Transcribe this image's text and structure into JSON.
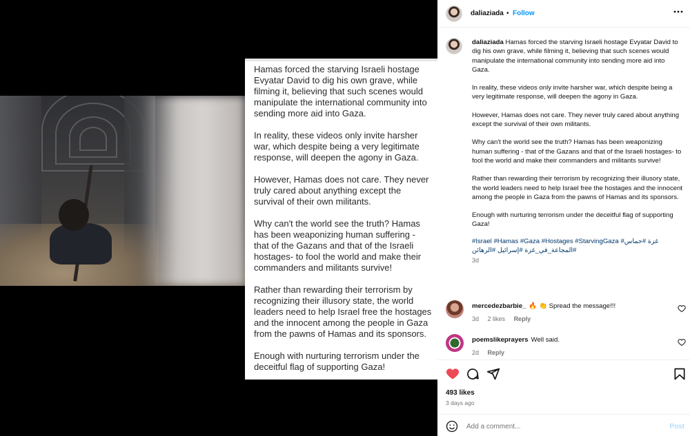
{
  "post": {
    "image_text": {
      "paragraphs": [
        "Hamas forced the starving Israeli hostage Evyatar David to dig his own grave, while filming it, believing that such scenes would manipulate the international community into sending more aid into Gaza.",
        "In reality, these videos only invite harsher war, which despite being a very legitimate response, will deepen the agony in Gaza.",
        "However, Hamas does not care. They never truly cared about anything except the survival of their own militants.",
        "Why can't the world see the truth? Hamas has been weaponizing human suffering - that of the Gazans and that of the Israeli hostages- to fool the world and make their commanders and militants survive!",
        "Rather than rewarding their terrorism by recognizing their illusory state, the world leaders need to help Israel free the hostages and the innocent among the people in Gaza from the pawns of Hamas and its sponsors.",
        "Enough with nurturing terrorism under the deceitful flag of supporting Gaza!"
      ]
    }
  },
  "header": {
    "username": "daliaziada",
    "separator": "•",
    "follow_label": "Follow",
    "more_icon": "more-horizontal-icon"
  },
  "caption": {
    "username": "daliaziada",
    "paragraphs": [
      "Hamas forced the starving Israeli hostage Evyatar David to dig his own grave, while filming it, believing that such scenes would manipulate the international community into sending more aid into Gaza.",
      "In reality, these videos only invite harsher war, which despite being a very legitimate response, will deepen the agony in Gaza.",
      "However, Hamas does not care. They never truly cared about anything except the survival of their own militants.",
      "Why can't the world see the truth? Hamas has been weaponizing human suffering - that of the Gazans and that of the Israeli hostages- to fool the world and make their commanders and militants survive!",
      "Rather than rewarding their terrorism by recognizing their illusory state, the world leaders need to help Israel free the hostages and the innocent among the people in Gaza from the pawns of Hamas and its sponsors.",
      "Enough with nurturing terrorism under the deceitful flag of supporting Gaza!"
    ],
    "hashtags_line1": "#Israel #Hamas #Gaza #Hostages #StarvingGaza #غزة #حماس",
    "hashtags_line2": "#المجاعة_في_غزة #إسرائيل #الرهائن",
    "time": "3d"
  },
  "comments": [
    {
      "username": "mercedezbarbie_",
      "text": "🔥 👏 Spread the message!!!",
      "time": "3d",
      "likes": "2 likes",
      "reply_label": "Reply"
    },
    {
      "username": "poemslikeprayers",
      "text": "Well said.",
      "time": "2d",
      "reply_label": "Reply"
    }
  ],
  "actions": {
    "likes": "493 likes",
    "posted_ago": "3 days ago",
    "comment_placeholder": "Add a comment...",
    "post_label": "Post"
  },
  "colors": {
    "like_red": "#ed4956",
    "link_blue": "#0095f6",
    "hashtag_blue": "#00376b",
    "muted_text": "#737373"
  }
}
